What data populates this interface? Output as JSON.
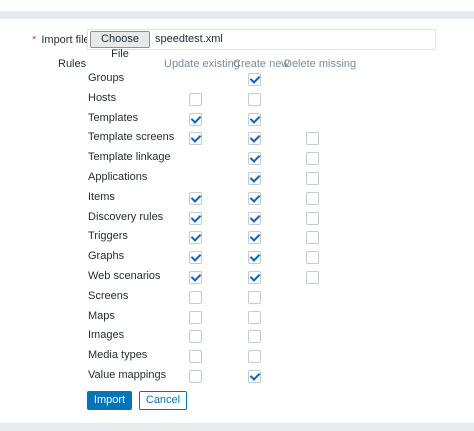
{
  "import_file": {
    "required_marker": "*",
    "label": "Import file",
    "choose_button": "Choose File",
    "file_name": "speedtest.xml"
  },
  "rules": {
    "label": "Rules",
    "columns": [
      "Update existing",
      "Create new",
      "Delete missing"
    ],
    "items": [
      {
        "label": "Groups",
        "update_existing": null,
        "create_new": true,
        "delete_missing": null
      },
      {
        "label": "Hosts",
        "update_existing": false,
        "create_new": false,
        "delete_missing": null
      },
      {
        "label": "Templates",
        "update_existing": true,
        "create_new": true,
        "delete_missing": null
      },
      {
        "label": "Template screens",
        "update_existing": true,
        "create_new": true,
        "delete_missing": false
      },
      {
        "label": "Template linkage",
        "update_existing": null,
        "create_new": true,
        "delete_missing": false
      },
      {
        "label": "Applications",
        "update_existing": null,
        "create_new": true,
        "delete_missing": false
      },
      {
        "label": "Items",
        "update_existing": true,
        "create_new": true,
        "delete_missing": false
      },
      {
        "label": "Discovery rules",
        "update_existing": true,
        "create_new": true,
        "delete_missing": false
      },
      {
        "label": "Triggers",
        "update_existing": true,
        "create_new": true,
        "delete_missing": false
      },
      {
        "label": "Graphs",
        "update_existing": true,
        "create_new": true,
        "delete_missing": false
      },
      {
        "label": "Web scenarios",
        "update_existing": true,
        "create_new": true,
        "delete_missing": false
      },
      {
        "label": "Screens",
        "update_existing": false,
        "create_new": false,
        "delete_missing": null
      },
      {
        "label": "Maps",
        "update_existing": false,
        "create_new": false,
        "delete_missing": null
      },
      {
        "label": "Images",
        "update_existing": false,
        "create_new": false,
        "delete_missing": null
      },
      {
        "label": "Media types",
        "update_existing": false,
        "create_new": false,
        "delete_missing": null
      },
      {
        "label": "Value mappings",
        "update_existing": false,
        "create_new": true,
        "delete_missing": null
      }
    ]
  },
  "buttons": {
    "import": "Import",
    "cancel": "Cancel"
  }
}
